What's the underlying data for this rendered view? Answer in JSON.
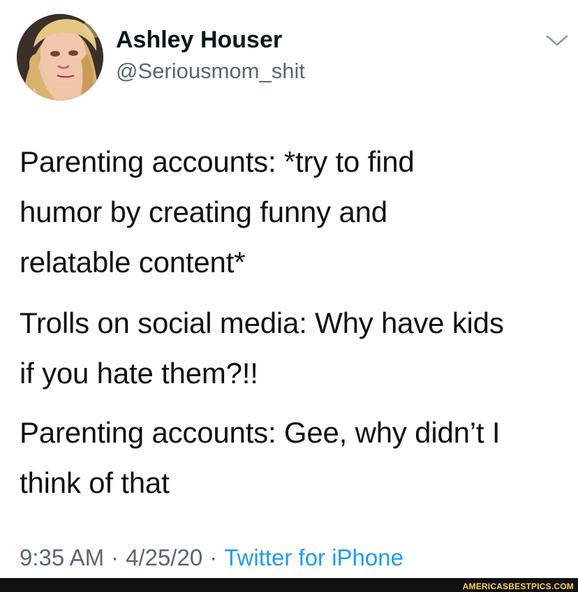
{
  "author": {
    "name": "Ashley Houser",
    "handle": "@Seriousmom_shit"
  },
  "tweet": {
    "paragraphs": [
      {
        "lines": [
          "Parenting accounts: *try to find",
          "humor by creating funny and",
          "relatable content*"
        ]
      },
      {
        "lines": [
          "Trolls on social media: Why have kids",
          "if you hate them?!!"
        ]
      },
      {
        "lines": [
          "Parenting accounts: Gee, why didn’t I",
          "think of that"
        ]
      }
    ]
  },
  "meta": {
    "time": "9:35 AM",
    "date": "4/25/20",
    "source": "Twitter for iPhone",
    "separator": "·"
  },
  "watermark": {
    "text": "AMERICASBESTPICS.COM"
  },
  "icons": {
    "avatar": "profile-photo",
    "more": "chevron-down-icon"
  },
  "colors": {
    "background": "#ffffff",
    "text": "#111111",
    "secondary": "#5b6670",
    "link": "#1d9bf0",
    "footer": "#111111",
    "watermark": "#ffd34f"
  }
}
